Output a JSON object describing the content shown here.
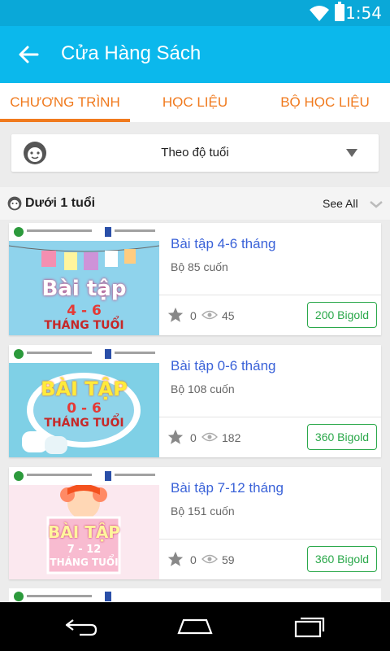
{
  "status_bar": {
    "time": "1:54",
    "wifi_icon": "wifi-icon",
    "battery_icon": "battery-icon"
  },
  "app_bar": {
    "title": "Cửa Hàng Sách",
    "back_icon": "arrow-left-icon"
  },
  "tabs": [
    {
      "label": "CHƯƠNG TRÌNH",
      "active": true
    },
    {
      "label": "HỌC LIỆU",
      "active": false
    },
    {
      "label": "BỘ HỌC LIỆU",
      "active": false
    }
  ],
  "filter": {
    "icon": "baby-face-icon",
    "selected": "Theo độ tuổi"
  },
  "section": {
    "icon": "baby-face-icon",
    "title": "Dưới 1 tuổi",
    "see_all": "See All"
  },
  "books": [
    {
      "title": "Bài tập 4-6 tháng",
      "subtitle": "Bộ 85 cuốn",
      "rating": "0",
      "views": "45",
      "price": "200 Bigold",
      "cover": {
        "line1": "Bài tập",
        "line2": "4 - 6",
        "line3": "THÁNG TUỔI",
        "bg": "#8fd3ec",
        "accent": "#e0428c"
      }
    },
    {
      "title": "Bài tập 0-6 tháng",
      "subtitle": "Bộ 108 cuốn",
      "rating": "0",
      "views": "182",
      "price": "360 Bigold",
      "cover": {
        "line1": "BÀI TẬP",
        "line2": "0 - 6",
        "line3": "THÁNG TUỔI",
        "bg": "#7fd0e6",
        "accent": "#f08a1c"
      }
    },
    {
      "title": "Bài tập 7-12 tháng",
      "subtitle": "Bộ 151 cuốn",
      "rating": "0",
      "views": "59",
      "price": "360 Bigold",
      "cover": {
        "line1": "BÀI TẬP",
        "line2": "7 - 12",
        "line3": "THÁNG TUỔI",
        "bg": "#fbe8ef",
        "accent": "#e75a92"
      }
    }
  ],
  "colors": {
    "status_bar": "#0aa8d8",
    "app_bar": "#0bb8ec",
    "tab_accent": "#f07a1e",
    "title_link": "#3a62d8",
    "price": "#2aa84a"
  },
  "nav_bar": {
    "back_icon": "nav-back-icon",
    "home_icon": "nav-home-icon",
    "recents_icon": "nav-recents-icon"
  }
}
